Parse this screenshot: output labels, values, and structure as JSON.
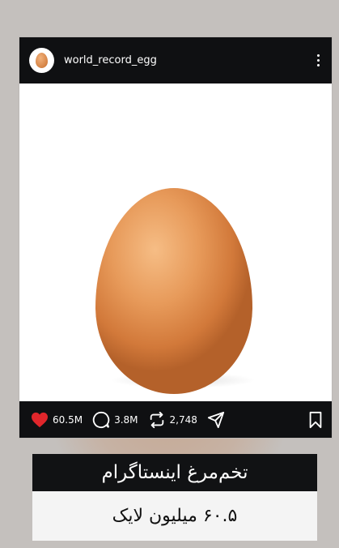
{
  "post": {
    "username": "world_record_egg",
    "likes": "60.5M",
    "comments": "3.8M",
    "reposts": "2,748"
  },
  "caption": {
    "title": "تخم‌مرغ اینستاگرام",
    "subtitle": "۶۰.۵ میلیون لایک"
  },
  "colors": {
    "header_bg": "#0f1012",
    "like": "#e0262b",
    "egg": "#e08a48"
  },
  "icons": [
    "avatar-egg-icon",
    "more-icon",
    "heart-icon",
    "comment-icon",
    "repost-icon",
    "share-icon",
    "bookmark-icon"
  ]
}
